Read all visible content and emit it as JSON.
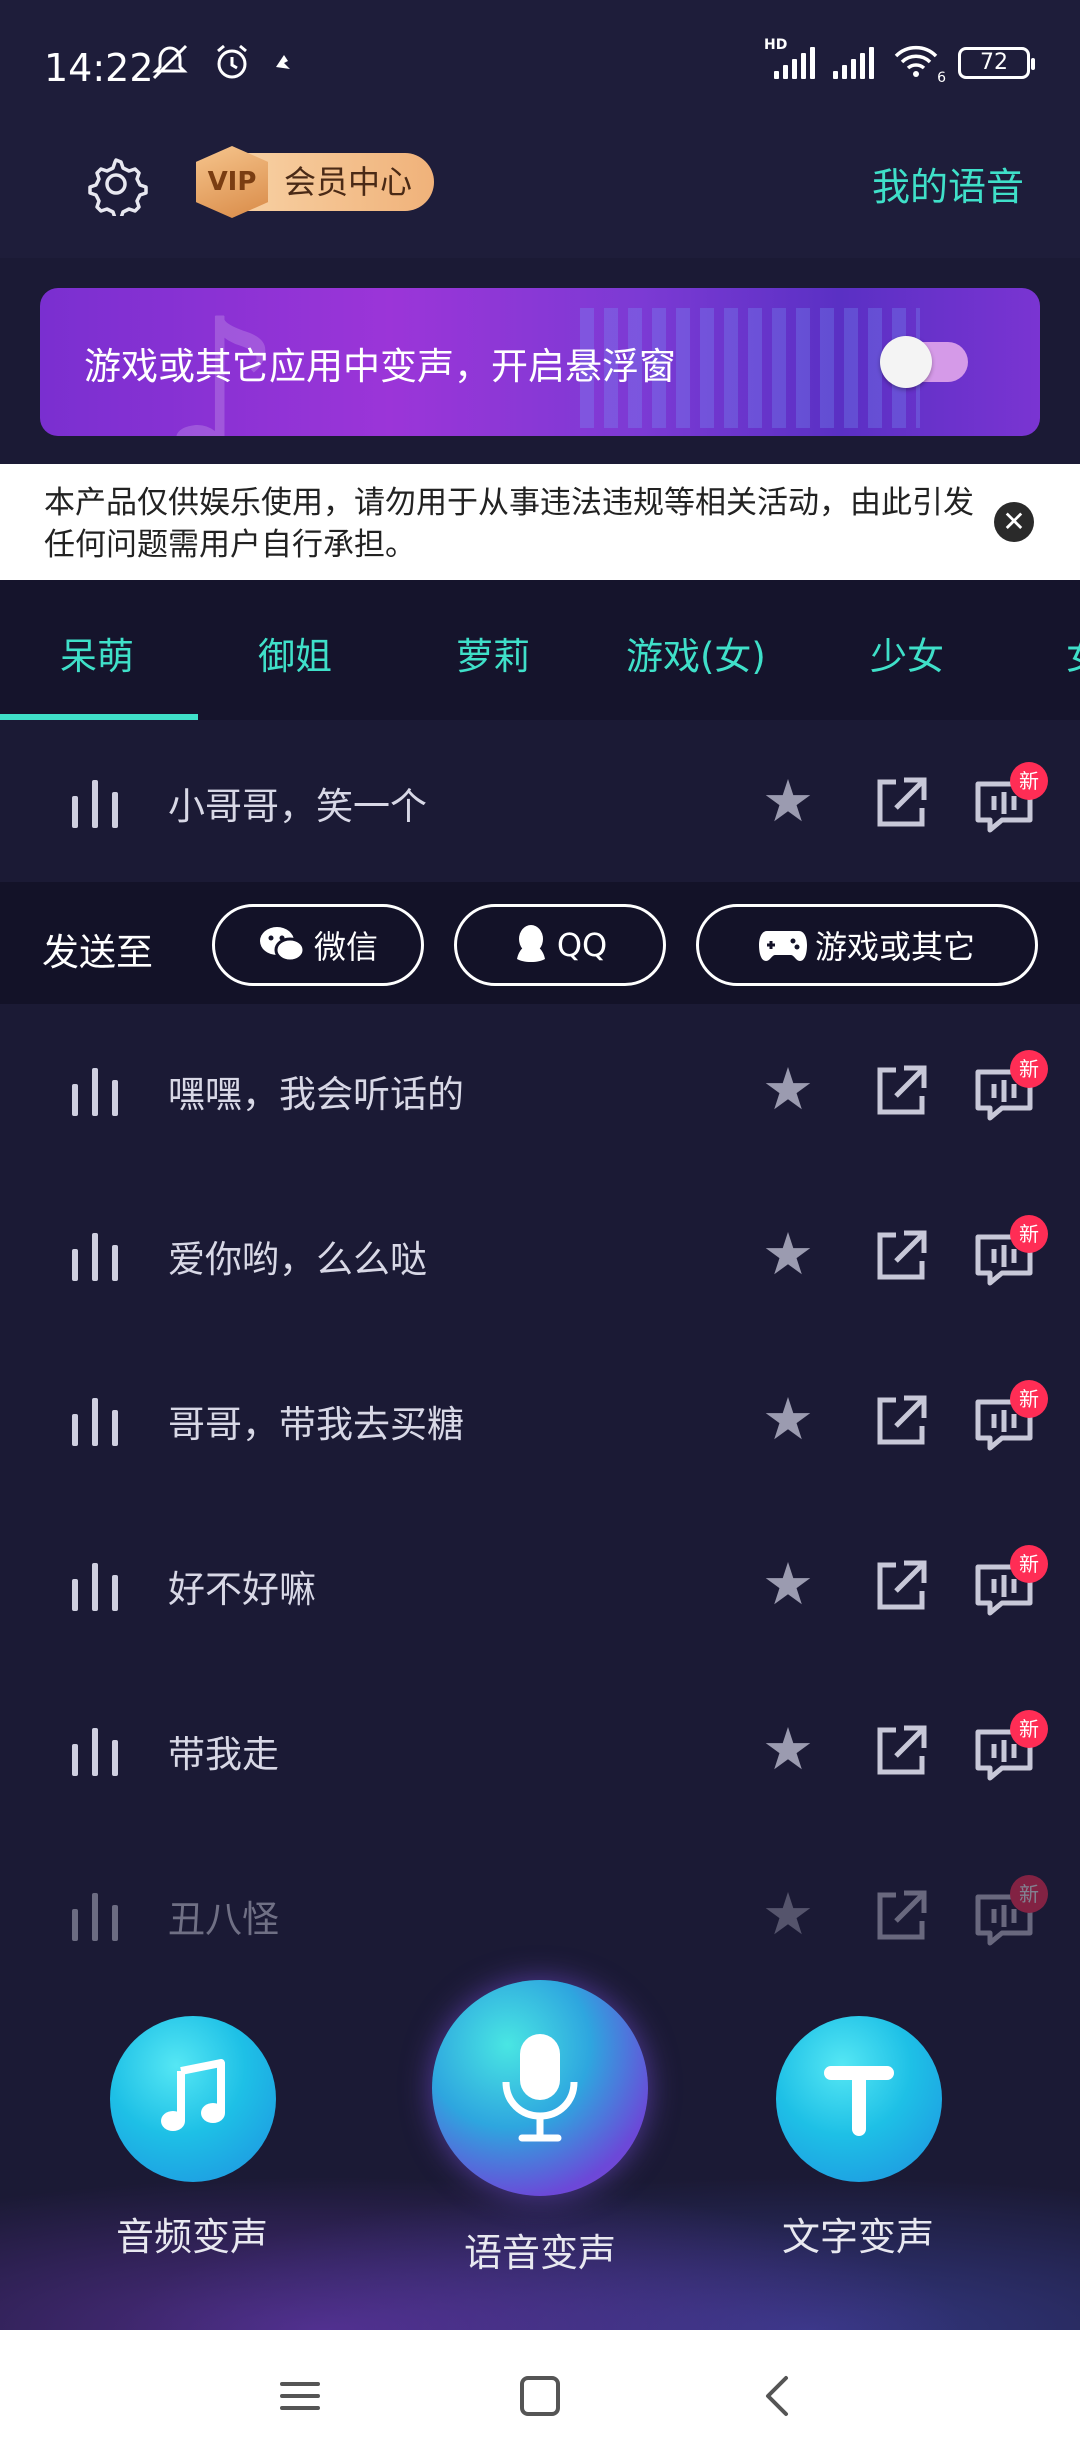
{
  "status_bar": {
    "time": "14:22",
    "battery": "72",
    "hd_label": "HD",
    "wifi_label": "6"
  },
  "header": {
    "vip_badge": "VIP",
    "vip_label": "会员中心",
    "my_voice": "我的语音"
  },
  "banner": {
    "text": "游戏或其它应用中变声，开启悬浮窗",
    "toggle_on": false
  },
  "disclaimer": {
    "text": "本产品仅供娱乐使用，请勿用于从事违法违规等相关活动，由此引发任何问题需用户自行承担。",
    "close_symbol": "✕"
  },
  "tabs": [
    {
      "label": "呆萌",
      "selected": true
    },
    {
      "label": "御姐"
    },
    {
      "label": "萝莉"
    },
    {
      "label": "游戏(女)"
    },
    {
      "label": "少女"
    },
    {
      "label": "女"
    }
  ],
  "send_bar": {
    "label": "发送至",
    "targets": [
      {
        "label": "微信",
        "icon": "wechat-icon"
      },
      {
        "label": "QQ",
        "icon": "qq-icon"
      },
      {
        "label": "游戏或其它",
        "icon": "gamepad-icon"
      }
    ]
  },
  "voices": [
    {
      "label": "小哥哥，笑一个",
      "badge": "新"
    },
    {
      "label": "嘿嘿，我会听话的",
      "badge": "新"
    },
    {
      "label": "爱你哟，么么哒",
      "badge": "新"
    },
    {
      "label": "哥哥，带我去买糖",
      "badge": "新"
    },
    {
      "label": "好不好嘛",
      "badge": "新"
    },
    {
      "label": "带我走",
      "badge": "新"
    },
    {
      "label": "丑八怪",
      "badge": "新"
    }
  ],
  "bottom_actions": [
    {
      "label": "音频变声",
      "icon": "music-note-icon"
    },
    {
      "label": "语音变声",
      "icon": "microphone-icon"
    },
    {
      "label": "文字变声",
      "icon": "text-t-icon"
    }
  ],
  "colors": {
    "accent": "#3fe0c9",
    "background": "#1b1a35",
    "badge": "#ff2d55"
  }
}
